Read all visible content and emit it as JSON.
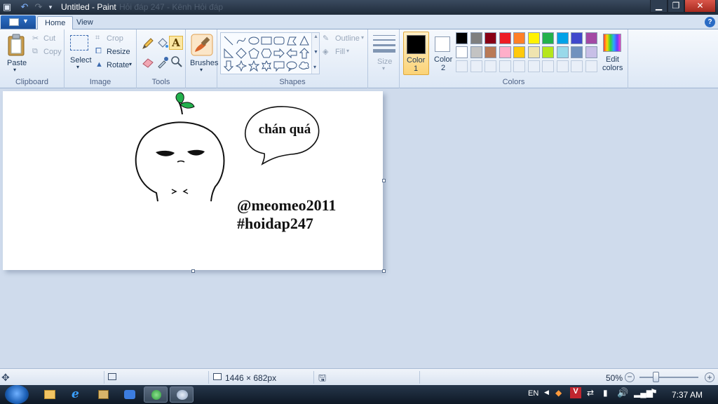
{
  "window": {
    "title": "Untitled - Paint",
    "ghost_text": "Hỏi đáp 247 - Kênh Hỏi đáp"
  },
  "tabs": [
    "Home",
    "View"
  ],
  "ribbon": {
    "clipboard": {
      "paste": "Paste",
      "cut": "Cut",
      "copy": "Copy",
      "label": "Clipboard"
    },
    "image": {
      "select": "Select",
      "crop": "Crop",
      "resize": "Resize",
      "rotate": "Rotate",
      "label": "Image"
    },
    "tools": {
      "label": "Tools"
    },
    "brushes": {
      "label": "Brushes"
    },
    "shapes": {
      "outline": "Outline",
      "fill": "Fill",
      "label": "Shapes"
    },
    "size": {
      "label": "Size"
    },
    "colors": {
      "color1": "Color 1",
      "color1_a": "Color",
      "color1_b": "1",
      "color2_a": "Color",
      "color2_b": "2",
      "edit_a": "Edit",
      "edit_b": "colors",
      "label": "Colors",
      "color1_value": "#000000",
      "color2_value": "#ffffff",
      "palette_row1": [
        "#000000",
        "#7f7f7f",
        "#880015",
        "#ed1c24",
        "#ff7f27",
        "#fff200",
        "#22b14c",
        "#00a2e8",
        "#3f48cc",
        "#a349a4"
      ],
      "palette_row2": [
        "#ffffff",
        "#c3c3c3",
        "#b97a57",
        "#ffaec9",
        "#ffc90e",
        "#efe4b0",
        "#b5e61d",
        "#99d9ea",
        "#7092be",
        "#c8bfe7"
      ]
    }
  },
  "canvas": {
    "speech": "chán quá",
    "handle": "@meomeo2011",
    "hashtag": "#hoidap247",
    "leaf_color": "#22b14c"
  },
  "status": {
    "dimensions": "1446 × 682px",
    "zoom": "50%"
  },
  "taskbar": {
    "language": "EN",
    "time": "7:37 AM"
  }
}
